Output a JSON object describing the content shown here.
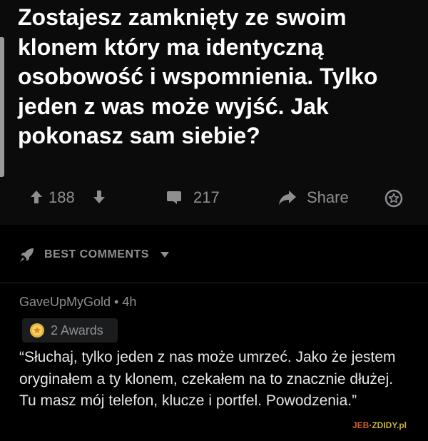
{
  "post": {
    "title": "Zostajesz zamknięty ze swoim klonem który ma identyczną osobowość i wspomnienia. Tylko jeden z was może wyjść. Jak pokonasz sam siebie?",
    "score": "188",
    "comments_count": "217",
    "share_label": "Share"
  },
  "sort": {
    "label": "BEST COMMENTS"
  },
  "comment": {
    "author_time": "GaveUpMyGold • 4h",
    "awards_label": "2 Awards",
    "body": "“Słuchaj, tylko jeden z nas może umrzeć. Jako że jestem oryginałem a ty klonem, czekałem na to znacznie dłużej. Tu masz mój telefon, klucze i portfel. Powodzenia.”"
  },
  "watermark": {
    "brand_a": "JEB",
    "brand_b": "ZDIDY",
    "suffix": ".pl"
  },
  "icons": {
    "upvote": "arrow-up-icon",
    "downvote": "arrow-down-icon",
    "comment": "comment-icon",
    "share": "share-arrow-icon",
    "award": "award-icon",
    "sort": "rocket-icon",
    "awards": "award-badge-icon"
  },
  "colors": {
    "background": "#000000",
    "post_background": "#0b0b0c",
    "text": "#ffffff",
    "muted": "#8d8f91"
  }
}
